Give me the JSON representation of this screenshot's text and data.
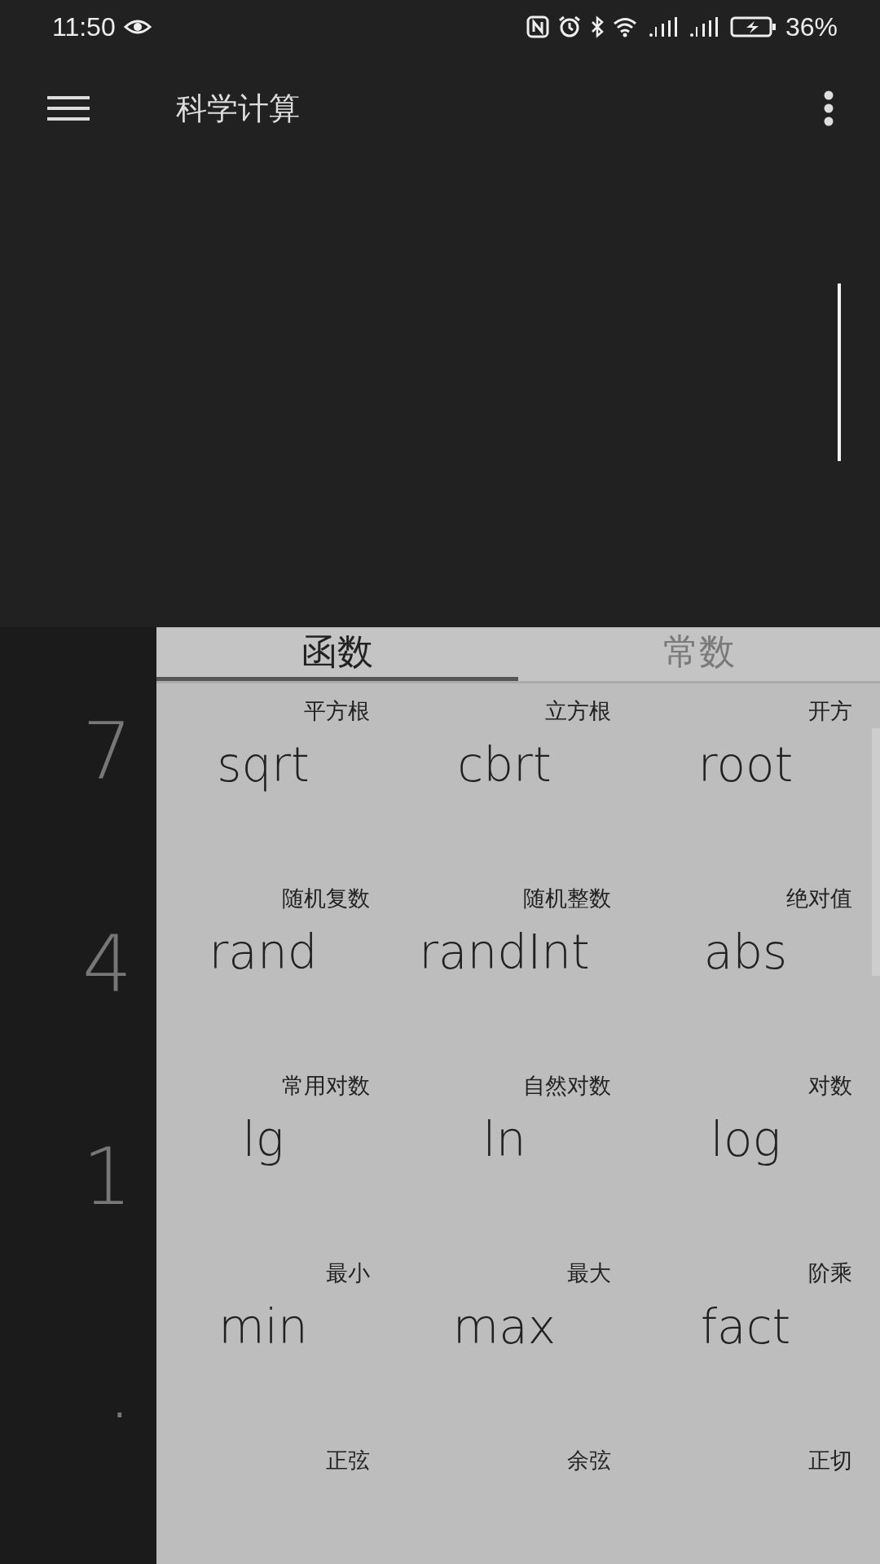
{
  "status_bar": {
    "time": "11:50",
    "battery_text": "36%"
  },
  "app_bar": {
    "title": "科学计算"
  },
  "keypad_digits": [
    "7",
    "4",
    "1",
    "."
  ],
  "tabs": [
    {
      "label": "函数",
      "selected": true
    },
    {
      "label": "常数",
      "selected": false
    }
  ],
  "functions": [
    {
      "label": "平方根",
      "name": "sqrt"
    },
    {
      "label": "立方根",
      "name": "cbrt"
    },
    {
      "label": "开方",
      "name": "root"
    },
    {
      "label": "随机复数",
      "name": "rand"
    },
    {
      "label": "随机整数",
      "name": "randInt"
    },
    {
      "label": "绝对值",
      "name": "abs"
    },
    {
      "label": "常用对数",
      "name": "lg"
    },
    {
      "label": "自然对数",
      "name": "ln"
    },
    {
      "label": "对数",
      "name": "log"
    },
    {
      "label": "最小",
      "name": "min"
    },
    {
      "label": "最大",
      "name": "max"
    },
    {
      "label": "阶乘",
      "name": "fact"
    },
    {
      "label": "正弦"
    },
    {
      "label": "余弦"
    },
    {
      "label": "正切"
    }
  ]
}
